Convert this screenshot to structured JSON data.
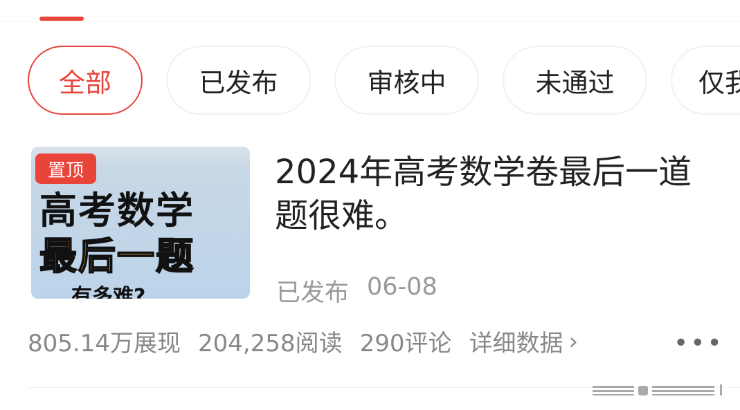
{
  "tabs": [
    {
      "label": "全部",
      "active": true
    },
    {
      "label": "已发布"
    },
    {
      "label": "审核中"
    },
    {
      "label": "未通过"
    },
    {
      "label": "仅我"
    }
  ],
  "article": {
    "thumbnail": {
      "pin_label": "置顶",
      "line1": "高考数学",
      "line2": "最后一题",
      "line3": "有多难?"
    },
    "title": "2024年高考数学卷最后一道题很难。",
    "status": "已发布",
    "date": "06-08",
    "stats": {
      "impressions": "805.14万展现",
      "reads": "204,258阅读",
      "comments": "290评论",
      "details_label": "详细数据"
    },
    "more_icon": "more-dots-icon"
  },
  "colors": {
    "accent": "#e8443a",
    "muted_text": "#999999",
    "thumb_bg": "#bcd4ea",
    "thumb_highlight": "#f5b82a"
  }
}
